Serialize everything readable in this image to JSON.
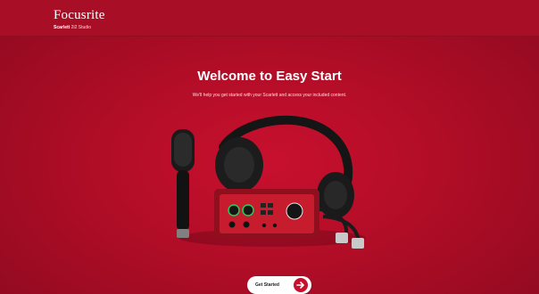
{
  "header": {
    "brand": "Focusrite",
    "product_bold": "Scarlett",
    "product_rest": "2i2 Studio"
  },
  "main": {
    "title": "Welcome to Easy Start",
    "subtitle": "We'll help you get started with your Scarlett and access your included content.",
    "cta_label": "Get Started"
  },
  "icons": {
    "cta": "arrow-right-icon"
  },
  "colors": {
    "background": "#b30f2a",
    "brand_red": "#c8102e",
    "button_bg": "#ffffff"
  }
}
